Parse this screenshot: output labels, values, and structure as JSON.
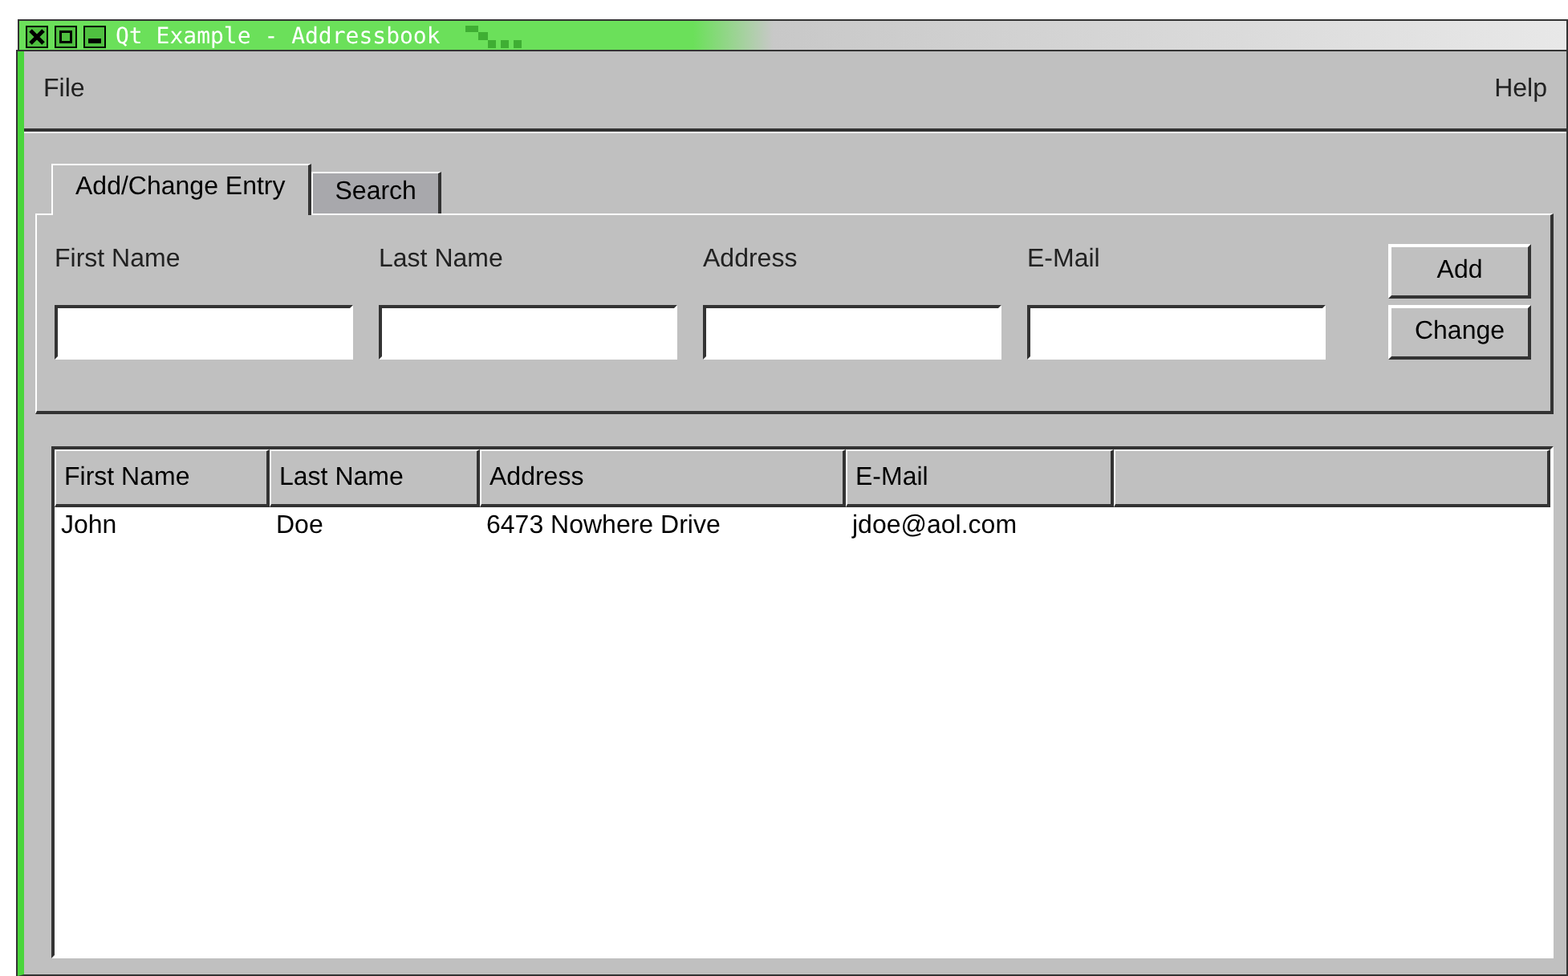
{
  "window": {
    "title": "Qt Example - Addressbook"
  },
  "menu": [
    "File",
    "Help"
  ],
  "tabs": [
    {
      "label": "Add/Change Entry",
      "selected": true
    },
    {
      "label": "Search",
      "selected": false
    }
  ],
  "form": {
    "fields": [
      {
        "label": "First Name"
      },
      {
        "label": "Last Name"
      },
      {
        "label": "Address"
      },
      {
        "label": "E-Mail"
      }
    ],
    "buttons": [
      "Add",
      "Change"
    ]
  },
  "table": {
    "columns": [
      "First Name",
      "Last Name",
      "Address",
      "E-Mail"
    ],
    "rows": [
      [
        "John",
        "Doe",
        "6473 Nowhere Drive",
        "jdoe@aol.com"
      ]
    ]
  }
}
